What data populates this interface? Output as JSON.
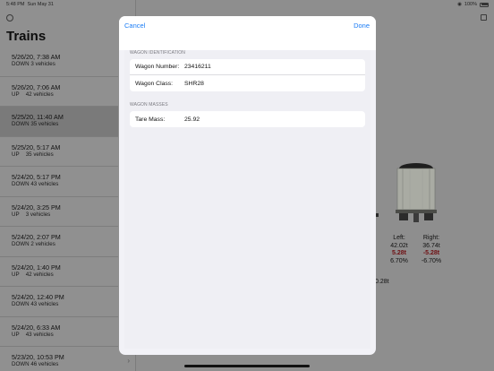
{
  "status_bar": {
    "time": "5:48 PM",
    "date": "Sun May 31",
    "battery": "100%"
  },
  "sidebar": {
    "title": "Trains",
    "trains": [
      {
        "datetime": "5/26/20, 7:38 AM",
        "direction": "DOWN",
        "vehicles": "3 vehicles"
      },
      {
        "datetime": "5/26/20, 7:06 AM",
        "direction": "UP",
        "vehicles": "42 vehicles"
      },
      {
        "datetime": "5/25/20, 11:40 AM",
        "direction": "DOWN",
        "vehicles": "35 vehicles",
        "selected": true
      },
      {
        "datetime": "5/25/20, 5:17 AM",
        "direction": "UP",
        "vehicles": "35 vehicles"
      },
      {
        "datetime": "5/24/20, 5:17 PM",
        "direction": "DOWN",
        "vehicles": "43 vehicles"
      },
      {
        "datetime": "5/24/20, 3:25 PM",
        "direction": "UP",
        "vehicles": "3 vehicles"
      },
      {
        "datetime": "5/24/20, 2:07 PM",
        "direction": "DOWN",
        "vehicles": "2 vehicles"
      },
      {
        "datetime": "5/24/20, 1:40 PM",
        "direction": "UP",
        "vehicles": "42 vehicles"
      },
      {
        "datetime": "5/24/20, 12:40 PM",
        "direction": "DOWN",
        "vehicles": "43 vehicles"
      },
      {
        "datetime": "5/24/20, 6:33 AM",
        "direction": "UP",
        "vehicles": "43 vehicles"
      },
      {
        "datetime": "5/23/20, 10:53 PM",
        "direction": "DOWN",
        "vehicles": "46 vehicles"
      }
    ]
  },
  "detail": {
    "left": {
      "label": "Left:",
      "mass": "42.02t",
      "delta": "5.28t",
      "percent": "6.70%"
    },
    "right": {
      "label": "Right:",
      "mass": "36.74t",
      "delta": "-5.28t",
      "percent": "-6.70%"
    },
    "partial_value": "0.28t"
  },
  "modal": {
    "cancel_label": "Cancel",
    "done_label": "Done",
    "identification_header": "WAGON IDENTIFICATION",
    "wagon_number_label": "Wagon Number:",
    "wagon_number_value": "23416211",
    "wagon_class_label": "Wagon Class:",
    "wagon_class_value": "SHR28",
    "masses_header": "WAGON MASSES",
    "tare_mass_label": "Tare Mass:",
    "tare_mass_value": "25.92"
  },
  "colors": {
    "accent": "#1a7cf5",
    "negative": "#d12b2b"
  }
}
